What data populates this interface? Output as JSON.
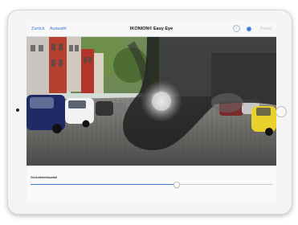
{
  "navbar": {
    "back_label": "Zurück",
    "select_label": "Auswahl",
    "title": "IKONION® Easy Eye",
    "info_icon": "info-icon",
    "settings_icon": "gear-icon",
    "reset_label": "Reset"
  },
  "simulation": {
    "scene": "street-photo-with-visual-impairment-overlay"
  },
  "slider": {
    "label": "Gesichtsfeldausfall",
    "value_fraction": 0.6
  },
  "colors": {
    "accent": "#3a7ad9",
    "disabled": "#b9c3d4"
  }
}
